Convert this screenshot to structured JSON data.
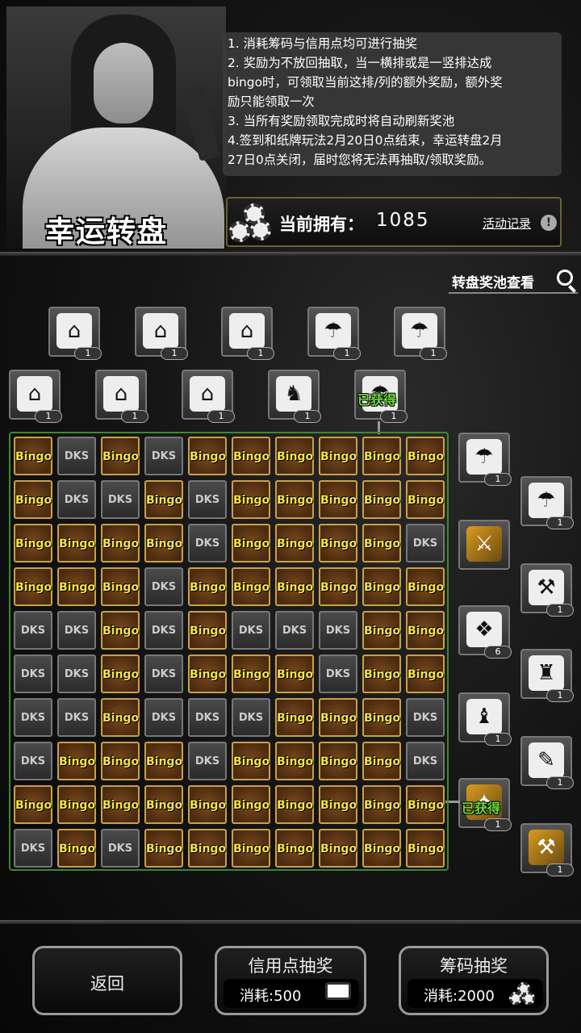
{
  "header": {
    "title": "幸运转盘",
    "rules": [
      "1. 消耗筹码与信用点均可进行抽奖",
      "2. 奖励为不放回抽取，当一横排或是一竖排达成",
      "bingo时，可领取当前这排/列的额外奖励，额外奖",
      "励只能领取一次",
      "3. 当所有奖励领取完成时将自动刷新奖池",
      "4.签到和纸牌玩法2月20日0点结束，幸运转盘2月",
      "27日0点关闭，届时您将无法再抽取/领取奖励。"
    ],
    "owned_label": "当前拥有：",
    "owned_amount": "1085",
    "record_label": "活动记录",
    "info_icon": "info-icon"
  },
  "pool_view_label": "转盘奖池查看",
  "column_rewards": [
    {
      "icon": "hanger-icon",
      "count": "1",
      "claimed": false
    },
    {
      "icon": "hanger-icon",
      "count": "1",
      "claimed": false
    },
    {
      "icon": "hanger-icon",
      "count": "1",
      "claimed": false
    },
    {
      "icon": "hanger-icon",
      "count": "1",
      "claimed": false
    },
    {
      "icon": "hanger-icon",
      "count": "1",
      "claimed": false
    },
    {
      "icon": "hanger-icon",
      "count": "1",
      "claimed": false
    },
    {
      "icon": "hanger-icon",
      "count": "1",
      "claimed": false
    },
    {
      "icon": "airdrop-icon",
      "count": "1",
      "claimed": false
    },
    {
      "icon": "airdrop-icon",
      "count": "1",
      "claimed": false
    },
    {
      "icon": "rabbit-icon",
      "count": "1",
      "claimed": false
    },
    {
      "icon": "airdrop-icon",
      "count": "1",
      "claimed": true
    }
  ],
  "row_rewards": [
    {
      "icon": "airdrop-icon",
      "count": "1",
      "claimed": false
    },
    {
      "icon": "airdrop-icon",
      "count": "1",
      "claimed": false
    },
    {
      "icon": "gold-gun-icon",
      "count": "",
      "claimed": false
    },
    {
      "icon": "hammer-icon",
      "count": "1",
      "claimed": false
    },
    {
      "icon": "card-pack-icon",
      "count": "6",
      "claimed": false
    },
    {
      "icon": "rabbit-suit-icon",
      "count": "1",
      "claimed": false
    },
    {
      "icon": "cat-suit-icon",
      "count": "1",
      "claimed": false
    },
    {
      "icon": "rifle-icon",
      "count": "1",
      "claimed": false
    },
    {
      "icon": "gold-weapon-icon",
      "count": "1",
      "claimed": true
    },
    {
      "icon": "gold-hammer-icon",
      "count": "1",
      "claimed": false
    }
  ],
  "claimed_label": "已获得",
  "grid": [
    [
      "B",
      "D",
      "B",
      "D",
      "B",
      "B",
      "B",
      "B",
      "B",
      "B"
    ],
    [
      "B",
      "D",
      "D",
      "B",
      "D",
      "B",
      "B",
      "B",
      "B",
      "B"
    ],
    [
      "B",
      "B",
      "B",
      "B",
      "D",
      "B",
      "B",
      "B",
      "B",
      "D"
    ],
    [
      "B",
      "B",
      "B",
      "D",
      "B",
      "B",
      "B",
      "B",
      "B",
      "B"
    ],
    [
      "D",
      "D",
      "B",
      "D",
      "B",
      "D",
      "D",
      "D",
      "B",
      "B"
    ],
    [
      "D",
      "D",
      "B",
      "D",
      "B",
      "B",
      "B",
      "D",
      "B",
      "B"
    ],
    [
      "D",
      "D",
      "B",
      "D",
      "D",
      "D",
      "B",
      "B",
      "B",
      "D"
    ],
    [
      "D",
      "B",
      "B",
      "B",
      "D",
      "B",
      "B",
      "B",
      "B",
      "D"
    ],
    [
      "B",
      "B",
      "B",
      "B",
      "B",
      "B",
      "B",
      "B",
      "B",
      "B"
    ],
    [
      "D",
      "B",
      "D",
      "B",
      "B",
      "B",
      "B",
      "B",
      "B",
      "B"
    ]
  ],
  "cell_labels": {
    "B": "Bingo",
    "D": "DKS"
  },
  "buttons": {
    "back": "返回",
    "credit_draw": "信用点抽奖",
    "credit_cost": "消耗:500",
    "chip_draw": "筹码抽奖",
    "chip_cost": "消耗:2000"
  }
}
